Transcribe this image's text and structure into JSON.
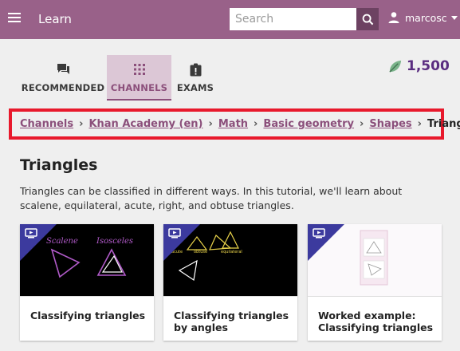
{
  "appbar": {
    "title": "Learn",
    "search_placeholder": "Search",
    "username": "marcosc"
  },
  "tabs": [
    {
      "label": "RECOMMENDED",
      "icon": "recommended-icon"
    },
    {
      "label": "CHANNELS",
      "icon": "channels-grid-icon",
      "active": true
    },
    {
      "label": "EXAMS",
      "icon": "exams-icon"
    }
  ],
  "points": {
    "value": "1,500",
    "icon": "leaf-points-icon"
  },
  "breadcrumb": {
    "items": [
      "Channels",
      "Khan Academy (en)",
      "Math",
      "Basic geometry",
      "Shapes"
    ],
    "current": "Triangles"
  },
  "topic": {
    "title": "Triangles",
    "description": "Triangles can be classified in different ways. In this tutorial, we'll learn about scalene, equilateral, acute, right, and obtuse triangles."
  },
  "cards": [
    {
      "title": "Classifying triangles",
      "kind": "video",
      "thumb_text": [
        "Scalene",
        "Isosceles"
      ]
    },
    {
      "title": "Classifying triangles by angles",
      "kind": "video",
      "thumb_text": [
        "acute",
        "obtuse",
        "equilateral"
      ]
    },
    {
      "title": "Worked example: Classifying triangles",
      "kind": "video"
    }
  ],
  "colors": {
    "appbar": "#996189",
    "accent": "#8b4f7b",
    "highlight_border": "#e8192c",
    "points": "#5a2d80",
    "content_badge": "#3c3a9e"
  }
}
